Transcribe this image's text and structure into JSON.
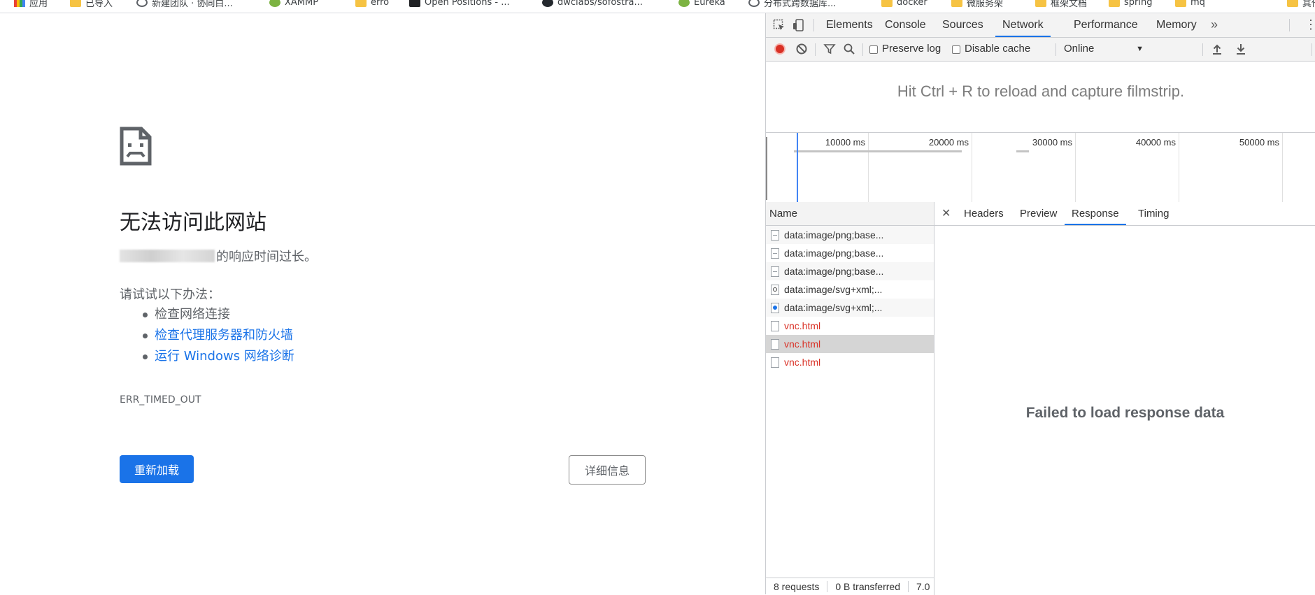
{
  "bookmarks": [
    {
      "label": "应用",
      "icon": "apps-icon"
    },
    {
      "label": "已导入",
      "icon": "folder-icon"
    },
    {
      "label": "新建团队 · 协同白...",
      "icon": "site-icon"
    },
    {
      "label": "XAMMP",
      "icon": "site-icon"
    },
    {
      "label": "erro",
      "icon": "folder-icon"
    },
    {
      "label": "Open Positions - ...",
      "icon": "site-icon"
    },
    {
      "label": "dwclabs/sofostra...",
      "icon": "github-icon"
    },
    {
      "label": "Eureka",
      "icon": "site-icon"
    },
    {
      "label": "分布式跨数据库...",
      "icon": "site-icon"
    },
    {
      "label": "docker",
      "icon": "folder-icon"
    },
    {
      "label": "微服务架",
      "icon": "folder-icon"
    },
    {
      "label": "框架文档",
      "icon": "folder-icon"
    },
    {
      "label": "spring",
      "icon": "folder-icon"
    },
    {
      "label": "mq",
      "icon": "folder-icon"
    },
    {
      "label": "其他",
      "icon": "folder-icon"
    }
  ],
  "error_page": {
    "title": "无法访问此网站",
    "description_suffix": "的响应时间过长。",
    "try_label": "请试试以下办法：",
    "suggestions": [
      "检查网络连接",
      "检查代理服务器和防火墙",
      "运行 Windows 网络诊断"
    ],
    "error_code": "ERR_TIMED_OUT",
    "reload_label": "重新加载",
    "details_label": "详细信息"
  },
  "devtools": {
    "tabs": [
      "Elements",
      "Console",
      "Sources",
      "Network",
      "Performance",
      "Memory"
    ],
    "active_tab": "Network",
    "toolbar": {
      "preserve_log": "Preserve log",
      "disable_cache": "Disable cache",
      "throttle": "Online"
    },
    "filmstrip_message": "Hit Ctrl + R to reload and capture filmstrip.",
    "timeline_labels": [
      "10000 ms",
      "20000 ms",
      "30000 ms",
      "40000 ms",
      "50000 ms"
    ],
    "name_header": "Name",
    "requests": [
      {
        "name": "data:image/png;base...",
        "error": false
      },
      {
        "name": "data:image/png;base...",
        "error": false
      },
      {
        "name": "data:image/png;base...",
        "error": false
      },
      {
        "name": "data:image/svg+xml;...",
        "error": false
      },
      {
        "name": "data:image/svg+xml;...",
        "error": false
      },
      {
        "name": "vnc.html",
        "error": true
      },
      {
        "name": "vnc.html",
        "error": true
      },
      {
        "name": "vnc.html",
        "error": true
      }
    ],
    "detail_tabs": [
      "Headers",
      "Preview",
      "Response",
      "Timing"
    ],
    "active_detail_tab": "Response",
    "response_message": "Failed to load response data",
    "status": {
      "requests": "8 requests",
      "transferred": "0 B transferred",
      "extra": "7.0"
    }
  },
  "colors": {
    "accent": "#1a73e8",
    "error_red": "#d93025",
    "record_red": "#d93025"
  }
}
